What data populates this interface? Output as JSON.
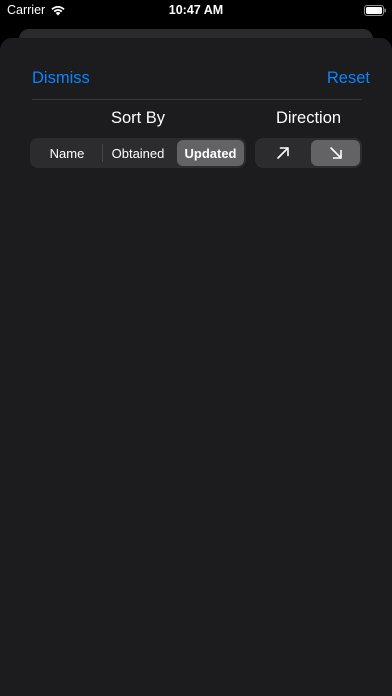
{
  "status_bar": {
    "carrier": "Carrier",
    "time": "10:47 AM",
    "wifi_icon": "wifi-icon",
    "battery_icon": "battery-icon"
  },
  "sheet": {
    "dismiss_label": "Dismiss",
    "reset_label": "Reset",
    "sort_by_label": "Sort By",
    "direction_label": "Direction",
    "sort_options": [
      {
        "label": "Name",
        "selected": false
      },
      {
        "label": "Obtained",
        "selected": false
      },
      {
        "label": "Updated",
        "selected": true
      }
    ],
    "direction_options": [
      {
        "icon": "arrow-up-right-icon",
        "selected": false
      },
      {
        "icon": "arrow-down-right-icon",
        "selected": true
      }
    ]
  },
  "colors": {
    "accent": "#0a84ff",
    "sheet_background": "#1c1c1e",
    "segment_background": "#2c2c2e",
    "segment_selected": "#636366"
  }
}
